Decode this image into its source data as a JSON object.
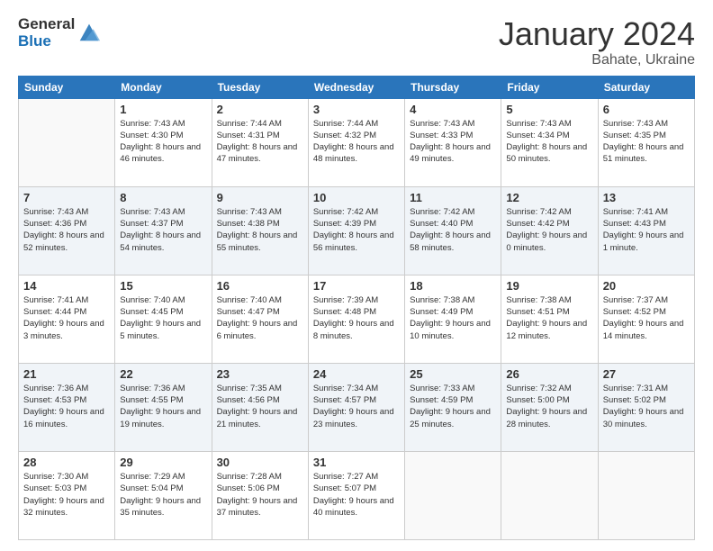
{
  "logo": {
    "general": "General",
    "blue": "Blue"
  },
  "title": "January 2024",
  "location": "Bahate, Ukraine",
  "days_header": [
    "Sunday",
    "Monday",
    "Tuesday",
    "Wednesday",
    "Thursday",
    "Friday",
    "Saturday"
  ],
  "weeks": [
    [
      {
        "day": "",
        "sunrise": "",
        "sunset": "",
        "daylight": ""
      },
      {
        "day": "1",
        "sunrise": "Sunrise: 7:43 AM",
        "sunset": "Sunset: 4:30 PM",
        "daylight": "Daylight: 8 hours and 46 minutes."
      },
      {
        "day": "2",
        "sunrise": "Sunrise: 7:44 AM",
        "sunset": "Sunset: 4:31 PM",
        "daylight": "Daylight: 8 hours and 47 minutes."
      },
      {
        "day": "3",
        "sunrise": "Sunrise: 7:44 AM",
        "sunset": "Sunset: 4:32 PM",
        "daylight": "Daylight: 8 hours and 48 minutes."
      },
      {
        "day": "4",
        "sunrise": "Sunrise: 7:43 AM",
        "sunset": "Sunset: 4:33 PM",
        "daylight": "Daylight: 8 hours and 49 minutes."
      },
      {
        "day": "5",
        "sunrise": "Sunrise: 7:43 AM",
        "sunset": "Sunset: 4:34 PM",
        "daylight": "Daylight: 8 hours and 50 minutes."
      },
      {
        "day": "6",
        "sunrise": "Sunrise: 7:43 AM",
        "sunset": "Sunset: 4:35 PM",
        "daylight": "Daylight: 8 hours and 51 minutes."
      }
    ],
    [
      {
        "day": "7",
        "sunrise": "Sunrise: 7:43 AM",
        "sunset": "Sunset: 4:36 PM",
        "daylight": "Daylight: 8 hours and 52 minutes."
      },
      {
        "day": "8",
        "sunrise": "Sunrise: 7:43 AM",
        "sunset": "Sunset: 4:37 PM",
        "daylight": "Daylight: 8 hours and 54 minutes."
      },
      {
        "day": "9",
        "sunrise": "Sunrise: 7:43 AM",
        "sunset": "Sunset: 4:38 PM",
        "daylight": "Daylight: 8 hours and 55 minutes."
      },
      {
        "day": "10",
        "sunrise": "Sunrise: 7:42 AM",
        "sunset": "Sunset: 4:39 PM",
        "daylight": "Daylight: 8 hours and 56 minutes."
      },
      {
        "day": "11",
        "sunrise": "Sunrise: 7:42 AM",
        "sunset": "Sunset: 4:40 PM",
        "daylight": "Daylight: 8 hours and 58 minutes."
      },
      {
        "day": "12",
        "sunrise": "Sunrise: 7:42 AM",
        "sunset": "Sunset: 4:42 PM",
        "daylight": "Daylight: 9 hours and 0 minutes."
      },
      {
        "day": "13",
        "sunrise": "Sunrise: 7:41 AM",
        "sunset": "Sunset: 4:43 PM",
        "daylight": "Daylight: 9 hours and 1 minute."
      }
    ],
    [
      {
        "day": "14",
        "sunrise": "Sunrise: 7:41 AM",
        "sunset": "Sunset: 4:44 PM",
        "daylight": "Daylight: 9 hours and 3 minutes."
      },
      {
        "day": "15",
        "sunrise": "Sunrise: 7:40 AM",
        "sunset": "Sunset: 4:45 PM",
        "daylight": "Daylight: 9 hours and 5 minutes."
      },
      {
        "day": "16",
        "sunrise": "Sunrise: 7:40 AM",
        "sunset": "Sunset: 4:47 PM",
        "daylight": "Daylight: 9 hours and 6 minutes."
      },
      {
        "day": "17",
        "sunrise": "Sunrise: 7:39 AM",
        "sunset": "Sunset: 4:48 PM",
        "daylight": "Daylight: 9 hours and 8 minutes."
      },
      {
        "day": "18",
        "sunrise": "Sunrise: 7:38 AM",
        "sunset": "Sunset: 4:49 PM",
        "daylight": "Daylight: 9 hours and 10 minutes."
      },
      {
        "day": "19",
        "sunrise": "Sunrise: 7:38 AM",
        "sunset": "Sunset: 4:51 PM",
        "daylight": "Daylight: 9 hours and 12 minutes."
      },
      {
        "day": "20",
        "sunrise": "Sunrise: 7:37 AM",
        "sunset": "Sunset: 4:52 PM",
        "daylight": "Daylight: 9 hours and 14 minutes."
      }
    ],
    [
      {
        "day": "21",
        "sunrise": "Sunrise: 7:36 AM",
        "sunset": "Sunset: 4:53 PM",
        "daylight": "Daylight: 9 hours and 16 minutes."
      },
      {
        "day": "22",
        "sunrise": "Sunrise: 7:36 AM",
        "sunset": "Sunset: 4:55 PM",
        "daylight": "Daylight: 9 hours and 19 minutes."
      },
      {
        "day": "23",
        "sunrise": "Sunrise: 7:35 AM",
        "sunset": "Sunset: 4:56 PM",
        "daylight": "Daylight: 9 hours and 21 minutes."
      },
      {
        "day": "24",
        "sunrise": "Sunrise: 7:34 AM",
        "sunset": "Sunset: 4:57 PM",
        "daylight": "Daylight: 9 hours and 23 minutes."
      },
      {
        "day": "25",
        "sunrise": "Sunrise: 7:33 AM",
        "sunset": "Sunset: 4:59 PM",
        "daylight": "Daylight: 9 hours and 25 minutes."
      },
      {
        "day": "26",
        "sunrise": "Sunrise: 7:32 AM",
        "sunset": "Sunset: 5:00 PM",
        "daylight": "Daylight: 9 hours and 28 minutes."
      },
      {
        "day": "27",
        "sunrise": "Sunrise: 7:31 AM",
        "sunset": "Sunset: 5:02 PM",
        "daylight": "Daylight: 9 hours and 30 minutes."
      }
    ],
    [
      {
        "day": "28",
        "sunrise": "Sunrise: 7:30 AM",
        "sunset": "Sunset: 5:03 PM",
        "daylight": "Daylight: 9 hours and 32 minutes."
      },
      {
        "day": "29",
        "sunrise": "Sunrise: 7:29 AM",
        "sunset": "Sunset: 5:04 PM",
        "daylight": "Daylight: 9 hours and 35 minutes."
      },
      {
        "day": "30",
        "sunrise": "Sunrise: 7:28 AM",
        "sunset": "Sunset: 5:06 PM",
        "daylight": "Daylight: 9 hours and 37 minutes."
      },
      {
        "day": "31",
        "sunrise": "Sunrise: 7:27 AM",
        "sunset": "Sunset: 5:07 PM",
        "daylight": "Daylight: 9 hours and 40 minutes."
      },
      {
        "day": "",
        "sunrise": "",
        "sunset": "",
        "daylight": ""
      },
      {
        "day": "",
        "sunrise": "",
        "sunset": "",
        "daylight": ""
      },
      {
        "day": "",
        "sunrise": "",
        "sunset": "",
        "daylight": ""
      }
    ]
  ]
}
